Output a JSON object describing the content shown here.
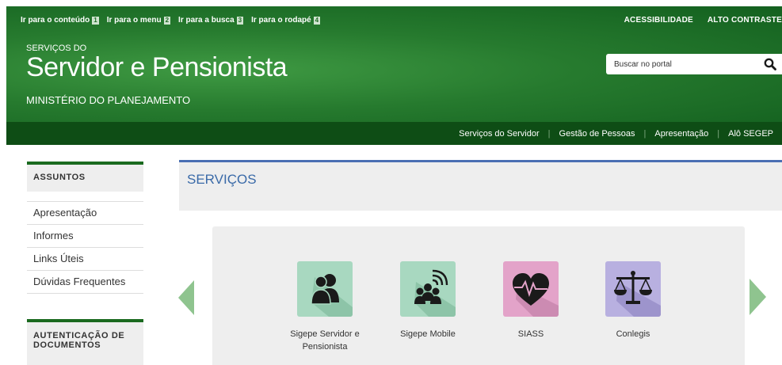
{
  "skip_links": [
    {
      "label": "Ir para o conteúdo",
      "key": "1"
    },
    {
      "label": "Ir para o menu",
      "key": "2"
    },
    {
      "label": "Ir para a busca",
      "key": "3"
    },
    {
      "label": "Ir para o rodapé",
      "key": "4"
    }
  ],
  "top_right": {
    "accessibility": "ACESSIBILIDADE",
    "contrast": "ALTO CONTRASTE"
  },
  "brand": {
    "pre": "SERVIÇOS DO",
    "title": "Servidor e Pensionista",
    "ministry": "MINISTÉRIO DO PLANEJAMENTO"
  },
  "search": {
    "placeholder": "Buscar no portal",
    "icon": "search-icon"
  },
  "nav": {
    "items": [
      "Serviços do Servidor",
      "Gestão de Pessoas",
      "Apresentação",
      "Alô SEGEP"
    ]
  },
  "sidebar": {
    "heading": "ASSUNTOS",
    "items": [
      "Apresentação",
      "Informes",
      "Links Úteis",
      "Dúvidas Frequentes"
    ],
    "heading2": "AUTENTICAÇÃO DE DOCUMENTOS"
  },
  "main": {
    "title": "SERVIÇOS",
    "tiles": [
      {
        "label": "Sigepe Servidor e Pensionista",
        "icon": "users-icon",
        "color": "#a8d8c0"
      },
      {
        "label": "Sigepe Mobile",
        "icon": "mobile-users-icon",
        "color": "#a8d8c0"
      },
      {
        "label": "SIASS",
        "icon": "heart-pulse-icon",
        "color": "#e3a3c9"
      },
      {
        "label": "Conlegis",
        "icon": "scales-icon",
        "color": "#b8b0e0"
      }
    ]
  },
  "colors": {
    "header_green": "#267a2e",
    "nav_green": "#0e4d15",
    "accent_blue": "#4a6fb3",
    "arrow_green": "#8fc48f"
  }
}
